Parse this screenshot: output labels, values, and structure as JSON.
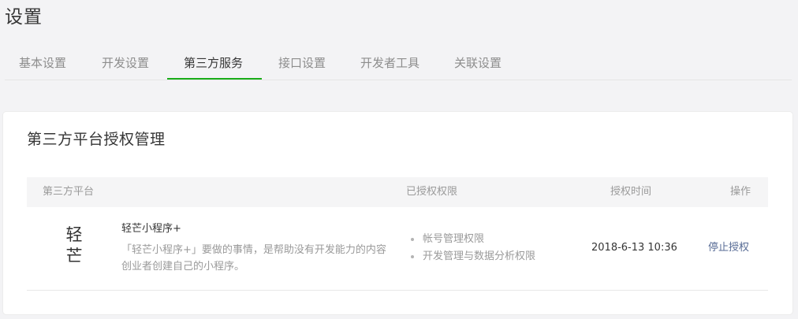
{
  "page": {
    "title": "设置"
  },
  "tabs": [
    {
      "label": "基本设置",
      "active": false
    },
    {
      "label": "开发设置",
      "active": false
    },
    {
      "label": "第三方服务",
      "active": true
    },
    {
      "label": "接口设置",
      "active": false
    },
    {
      "label": "开发者工具",
      "active": false
    },
    {
      "label": "关联设置",
      "active": false
    }
  ],
  "colors": {
    "accent": "#1aad19",
    "link": "#576b95",
    "background": "#f3f3f5"
  },
  "panel": {
    "title": "第三方平台授权管理",
    "columns": {
      "platform": "第三方平台",
      "permissions": "已授权权限",
      "time": "授权时间",
      "action": "操作"
    },
    "rows": [
      {
        "logo_text": "轻芒",
        "name": "轻芒小程序+",
        "description": "「轻芒小程序+」要做的事情，是帮助没有开发能力的内容创业者创建自己的小程序。",
        "permissions": [
          "帐号管理权限",
          "开发管理与数据分析权限"
        ],
        "time": "2018-6-13 10:36",
        "action": "停止授权"
      }
    ]
  }
}
